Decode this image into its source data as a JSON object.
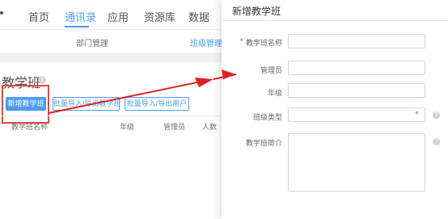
{
  "top_nav": {
    "items": [
      {
        "label": "首页",
        "active": false
      },
      {
        "label": "通讯录",
        "active": true
      },
      {
        "label": "应用",
        "active": false
      },
      {
        "label": "资源库",
        "active": false
      },
      {
        "label": "数据",
        "active": false
      }
    ]
  },
  "sub_nav": {
    "items": [
      {
        "label": "部门管理",
        "active": false
      },
      {
        "label": "班级管理",
        "active": true
      }
    ]
  },
  "page": {
    "title": "教学班",
    "help_glyph": "?"
  },
  "toolbar": {
    "add_button": "新增教学班",
    "import_class_button": "批量导入/导出教学班",
    "import_user_button": "批量导入/导出用户"
  },
  "table": {
    "headers": [
      "教学班名称",
      "年级",
      "管理员",
      "人数"
    ]
  },
  "drawer": {
    "title": "新增教学班",
    "fields": {
      "name_label": "教学班名称",
      "name_required": "*",
      "admin_label": "管理员",
      "grade_label": "年级",
      "type_label": "班级类型",
      "intro_label": "教学班简介"
    },
    "info_glyph": "?",
    "select_caret": "▼"
  },
  "colors": {
    "accent": "#2d8cf0",
    "highlight_red": "#e02020"
  },
  "icons": {
    "help": "question-circle-icon",
    "info": "question-circle-icon",
    "caret": "chevron-down-icon",
    "arrow": "red-arrow-annotation"
  }
}
